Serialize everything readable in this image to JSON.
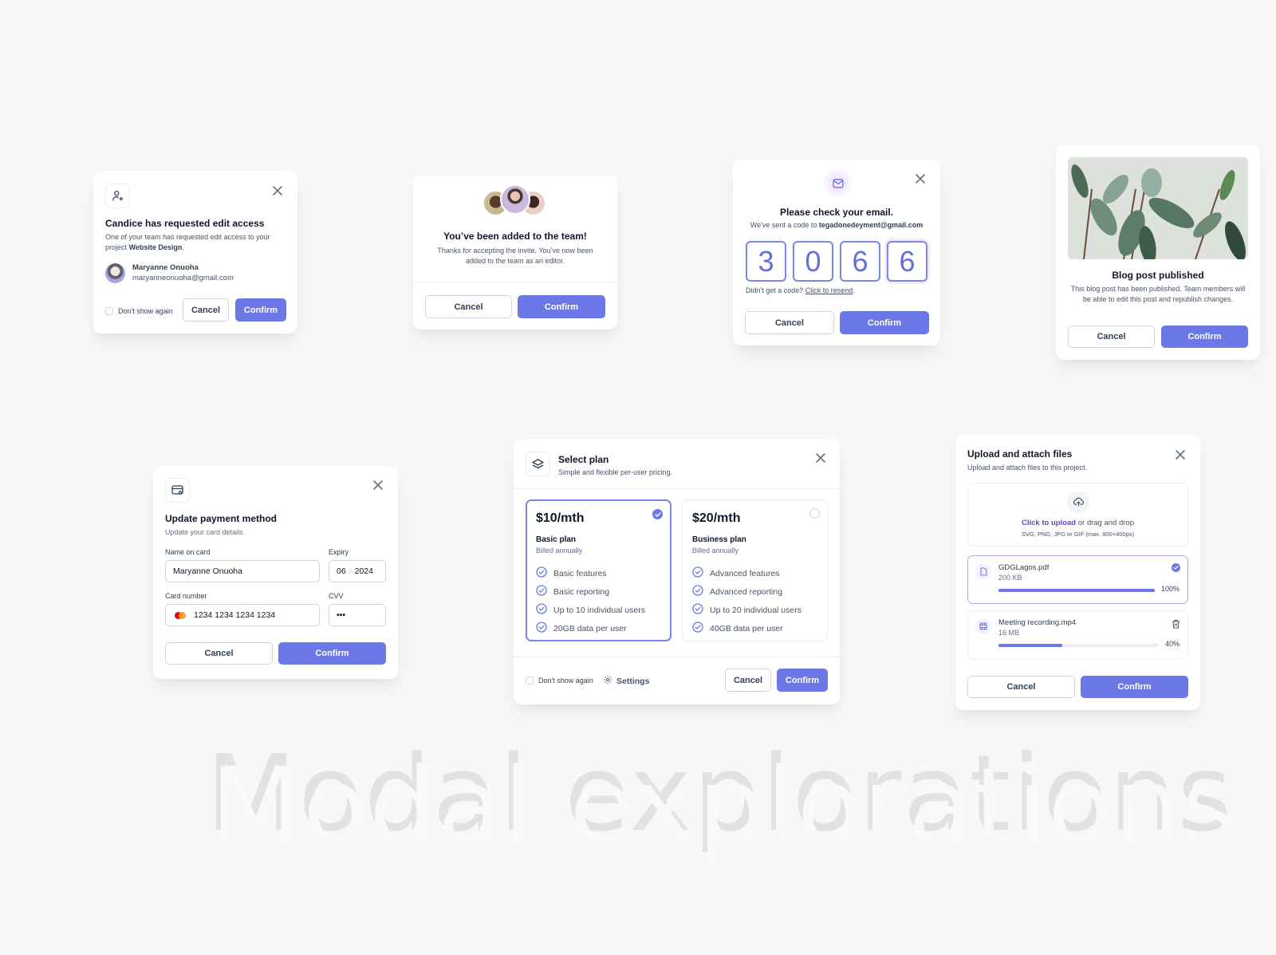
{
  "background_title": "Modal explorations",
  "colors": {
    "primary": "#6c78e6",
    "primary_light": "#f4f3ff",
    "border": "#d0d5dd",
    "text_dark": "#101828",
    "text_muted": "#475467",
    "link_purple": "#6941c6"
  },
  "edit_access": {
    "icon": "user-plus-icon",
    "title": "Candice has requested edit access",
    "desc_prefix": "One of your team has requested edit access to your project ",
    "desc_project": "Website Design",
    "desc_suffix": ".",
    "user_name": "Maryanne Onuoha",
    "user_email": "maryanneonuoha@gmail.com",
    "checkbox_label": "Don't show again",
    "cancel_label": "Cancel",
    "confirm_label": "Confirm"
  },
  "team_added": {
    "title": "You’ve been added to the team!",
    "desc": "Thanks for accepting the invite. You’ve now been added to the team as an editor.",
    "cancel_label": "Cancel",
    "confirm_label": "Confirm"
  },
  "check_email": {
    "icon": "mail-icon",
    "title": "Please check your email.",
    "desc_prefix": "We've sent a code to ",
    "email": "tegadonedeyment@gmail.com",
    "code_digits": [
      "3",
      "0",
      "6",
      "6"
    ],
    "resend_prefix": "Didn't get a code? ",
    "resend_link": "Click to resend",
    "resend_suffix": ".",
    "cancel_label": "Cancel",
    "confirm_label": "Confirm"
  },
  "blog_published": {
    "image": "plant-leaves-photo",
    "title": "Blog post published",
    "desc": "This blog post has been published. Team members will be able to edit this post and republish changes.",
    "cancel_label": "Cancel",
    "confirm_label": "Confirm"
  },
  "payment": {
    "icon": "credit-card-icon",
    "title": "Update payment method",
    "desc": "Update your card details.",
    "name_label": "Name on card",
    "name_value": "Maryanne Onuoha",
    "expiry_label": "Expiry",
    "expiry_month": "06",
    "expiry_sep": "/",
    "expiry_year": "2024",
    "card_label": "Card number",
    "card_value": "1234 1234 1234 1234",
    "cvv_label": "CVV",
    "cvv_value": "•••",
    "cancel_label": "Cancel",
    "confirm_label": "Confirm"
  },
  "select_plan": {
    "icon": "layers-icon",
    "title": "Select plan",
    "desc": "Simple and flexible per-user pricing.",
    "plans": [
      {
        "price": "$10/mth",
        "name": "Basic plan",
        "billing": "Billed annually",
        "selected": true,
        "features": [
          "Basic features",
          "Basic reporting",
          "Up to 10 individual users",
          "20GB data per user"
        ]
      },
      {
        "price": "$20/mth",
        "name": "Business plan",
        "billing": "Billed annually",
        "selected": false,
        "features": [
          "Advanced features",
          "Advanced reporting",
          "Up to 20 individual users",
          "40GB data per user"
        ]
      }
    ],
    "checkbox_label": "Don't show again",
    "settings_label": "Settings",
    "cancel_label": "Cancel",
    "confirm_label": "Confirm"
  },
  "upload": {
    "title": "Upload and attach files",
    "desc": "Upload and attach files to this project.",
    "dropzone_link": "Click to upload",
    "dropzone_text": " or drag and drop",
    "dropzone_hint": "SVG, PNG, JPG or GIF (max. 800×400px)",
    "files": [
      {
        "name": "GDGLagos.pdf",
        "size": "200 KB",
        "progress": 100,
        "progress_label": "100%",
        "status": "complete"
      },
      {
        "name": "Meeting recording.mp4",
        "size": "16 MB",
        "progress": 40,
        "progress_label": "40%",
        "status": "uploading"
      }
    ],
    "cancel_label": "Cancel",
    "confirm_label": "Confirm"
  }
}
